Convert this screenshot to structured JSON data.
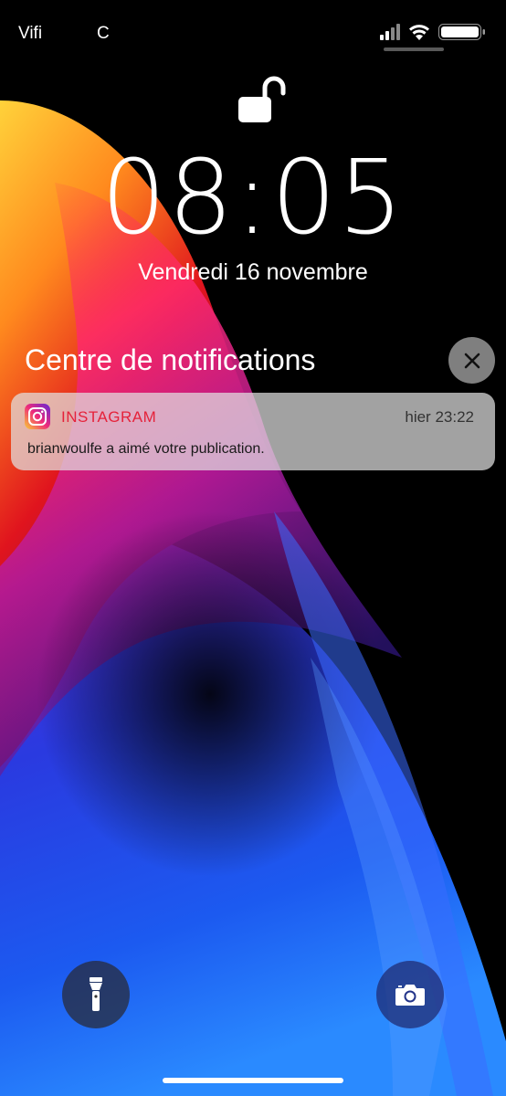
{
  "status_bar": {
    "carrier": "Vifi",
    "carrier_extra": "C",
    "icons": [
      "signal-icon",
      "wifi-icon",
      "battery-icon"
    ]
  },
  "lock_screen": {
    "lock_state_icon": "unlocked-padlock-icon",
    "time": "08:05",
    "date": "Vendredi 16 novembre"
  },
  "notification_center": {
    "title": "Centre de notifications",
    "close_icon": "close-icon",
    "notifications": [
      {
        "app_icon": "instagram-icon",
        "app_name": "INSTAGRAM",
        "time": "hier 23:22",
        "body": "brianwoulfe a aimé votre publication."
      }
    ]
  },
  "quick_actions": {
    "flashlight_icon": "flashlight-icon",
    "camera_icon": "camera-icon"
  },
  "colors": {
    "instagram_red": "#e5223a",
    "background": "#000000"
  }
}
